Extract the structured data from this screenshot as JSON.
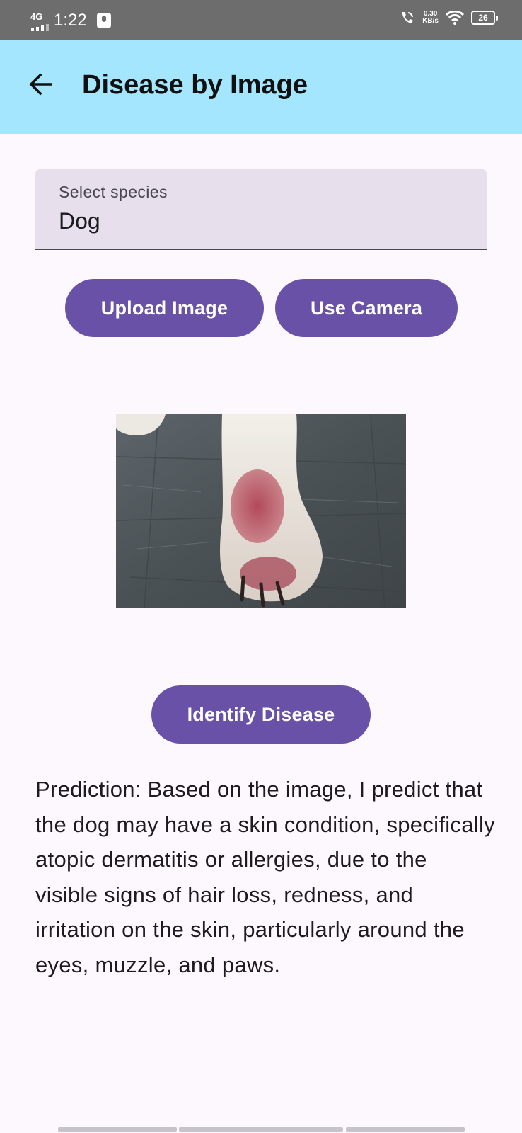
{
  "status_bar": {
    "network": "4G",
    "time": "1:22",
    "speed_value": "0.30",
    "speed_unit": "KB/s",
    "battery": "26"
  },
  "app_bar": {
    "title": "Disease by Image",
    "back_icon": "arrow-left-icon"
  },
  "species_select": {
    "label": "Select species",
    "value": "Dog"
  },
  "buttons": {
    "upload": "Upload Image",
    "camera": "Use Camera",
    "identify": "Identify Disease"
  },
  "result": {
    "prediction": "Prediction: Based on the image, I predict that the dog may have a skin condition, specifically atopic dermatitis or allergies, due to the visible signs of hair loss, redness, and irritation on the skin, particularly around the eyes, muzzle, and paws."
  },
  "colors": {
    "app_bar": "#a4e6fd",
    "primary": "#6a51a8",
    "background": "#fdf8fd",
    "field": "#e7e0ec"
  }
}
